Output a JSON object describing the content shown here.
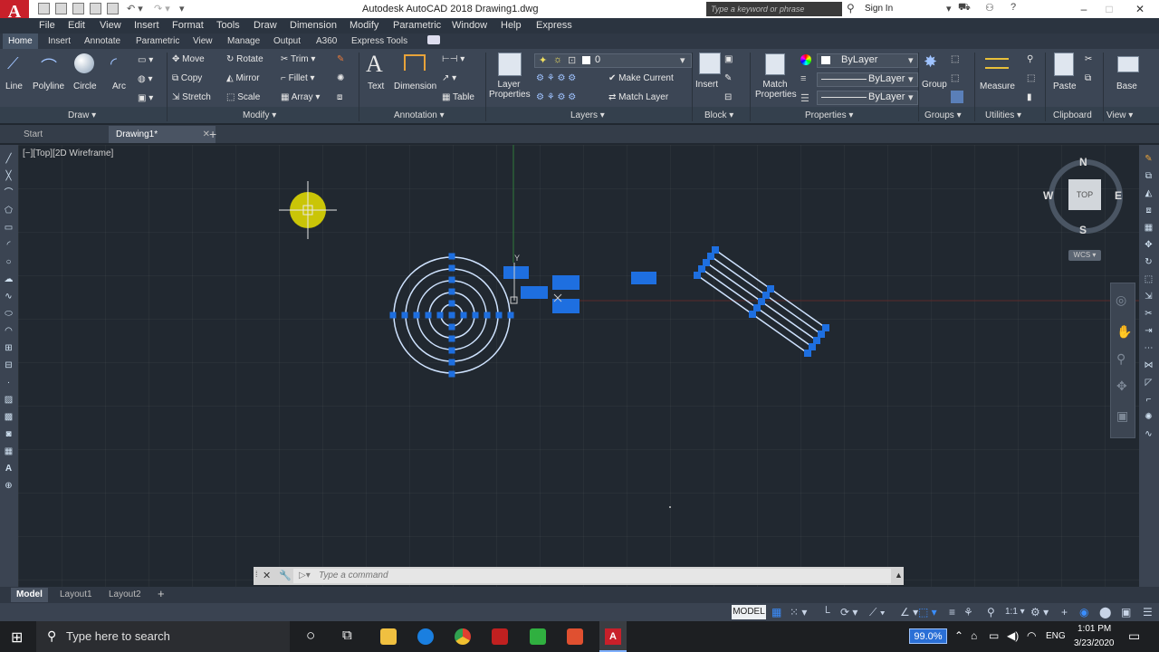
{
  "window": {
    "title": "Autodesk AutoCAD 2018    Drawing1.dwg",
    "logo": "A",
    "search_placeholder": "Type a keyword or phrase",
    "sign_in": "Sign In"
  },
  "menu": [
    "File",
    "Edit",
    "View",
    "Insert",
    "Format",
    "Tools",
    "Draw",
    "Dimension",
    "Modify",
    "Parametric",
    "Window",
    "Help",
    "Express"
  ],
  "ribbon_tabs": [
    "Home",
    "Insert",
    "Annotate",
    "Parametric",
    "View",
    "Manage",
    "Output",
    "A360",
    "Express Tools"
  ],
  "ribbon": {
    "draw": {
      "title": "Draw",
      "line": "Line",
      "polyline": "Polyline",
      "circle": "Circle",
      "arc": "Arc"
    },
    "modify": {
      "title": "Modify",
      "move": "Move",
      "rotate": "Rotate",
      "trim": "Trim",
      "copy": "Copy",
      "mirror": "Mirror",
      "fillet": "Fillet",
      "stretch": "Stretch",
      "scale": "Scale",
      "array": "Array"
    },
    "annotation": {
      "title": "Annotation",
      "text": "Text",
      "dimension": "Dimension",
      "table": "Table"
    },
    "layers": {
      "title": "Layers",
      "properties": "Layer Properties",
      "current_layer": "0",
      "make_current": "Make Current",
      "match_layer": "Match Layer"
    },
    "block": {
      "title": "Block",
      "insert": "Insert"
    },
    "properties": {
      "title": "Properties",
      "match": "Match Properties",
      "color": "ByLayer",
      "linetype": "ByLayer",
      "lineweight": "ByLayer"
    },
    "groups": {
      "title": "Groups",
      "group": "Group"
    },
    "utilities": {
      "title": "Utilities",
      "measure": "Measure"
    },
    "clipboard": {
      "title": "Clipboard",
      "paste": "Paste"
    },
    "view": {
      "title": "View",
      "base": "Base"
    }
  },
  "file_tabs": [
    "Start",
    "Drawing1*"
  ],
  "viewport_label": "[−][Top][2D Wireframe]",
  "viewcube": {
    "n": "N",
    "s": "S",
    "e": "E",
    "w": "W",
    "face": "TOP",
    "wcs": "WCS"
  },
  "command_placeholder": "Type a command",
  "layout_tabs": [
    "Model",
    "Layout1",
    "Layout2"
  ],
  "status": {
    "model": "MODEL",
    "scale": "1:1"
  },
  "taskbar": {
    "search": "Type here to search",
    "zoom": "99.0%",
    "lang": "ENG",
    "time": "1:01 PM",
    "date": "3/23/2020"
  },
  "colors": {
    "grip": "#1e6fe0",
    "circle": "#cfe3ff",
    "highlight": "#f0e000",
    "accent": "#2a6fd6"
  }
}
